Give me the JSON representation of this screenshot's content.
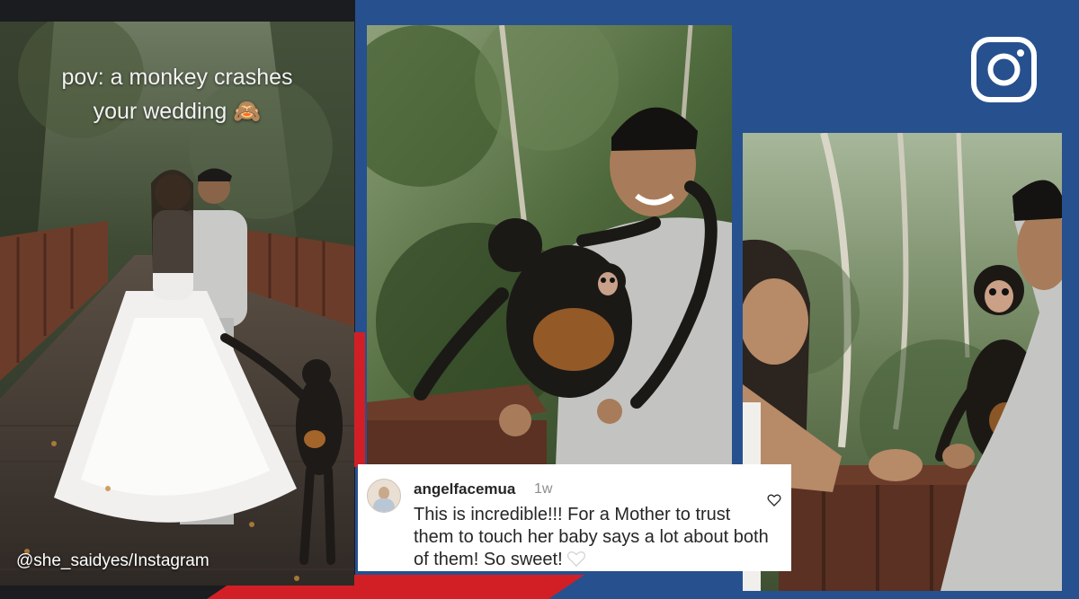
{
  "caption": {
    "line1": "pov: a monkey crashes",
    "line2": "your wedding 🙈"
  },
  "credit": "@she_saidyes/Instagram",
  "comment": {
    "username": "angelfacemua",
    "time": "1w",
    "text": "This is incredible!!! For a Mother to trust them to touch her baby says a lot about both of them! So sweet!"
  },
  "icons": {
    "brand": "instagram-icon",
    "like": "heart-outline-icon",
    "emoji": "white-heart-icon"
  },
  "colors": {
    "blue": "#27508f",
    "red": "#d21f26",
    "dark": "#1a1c1f"
  }
}
